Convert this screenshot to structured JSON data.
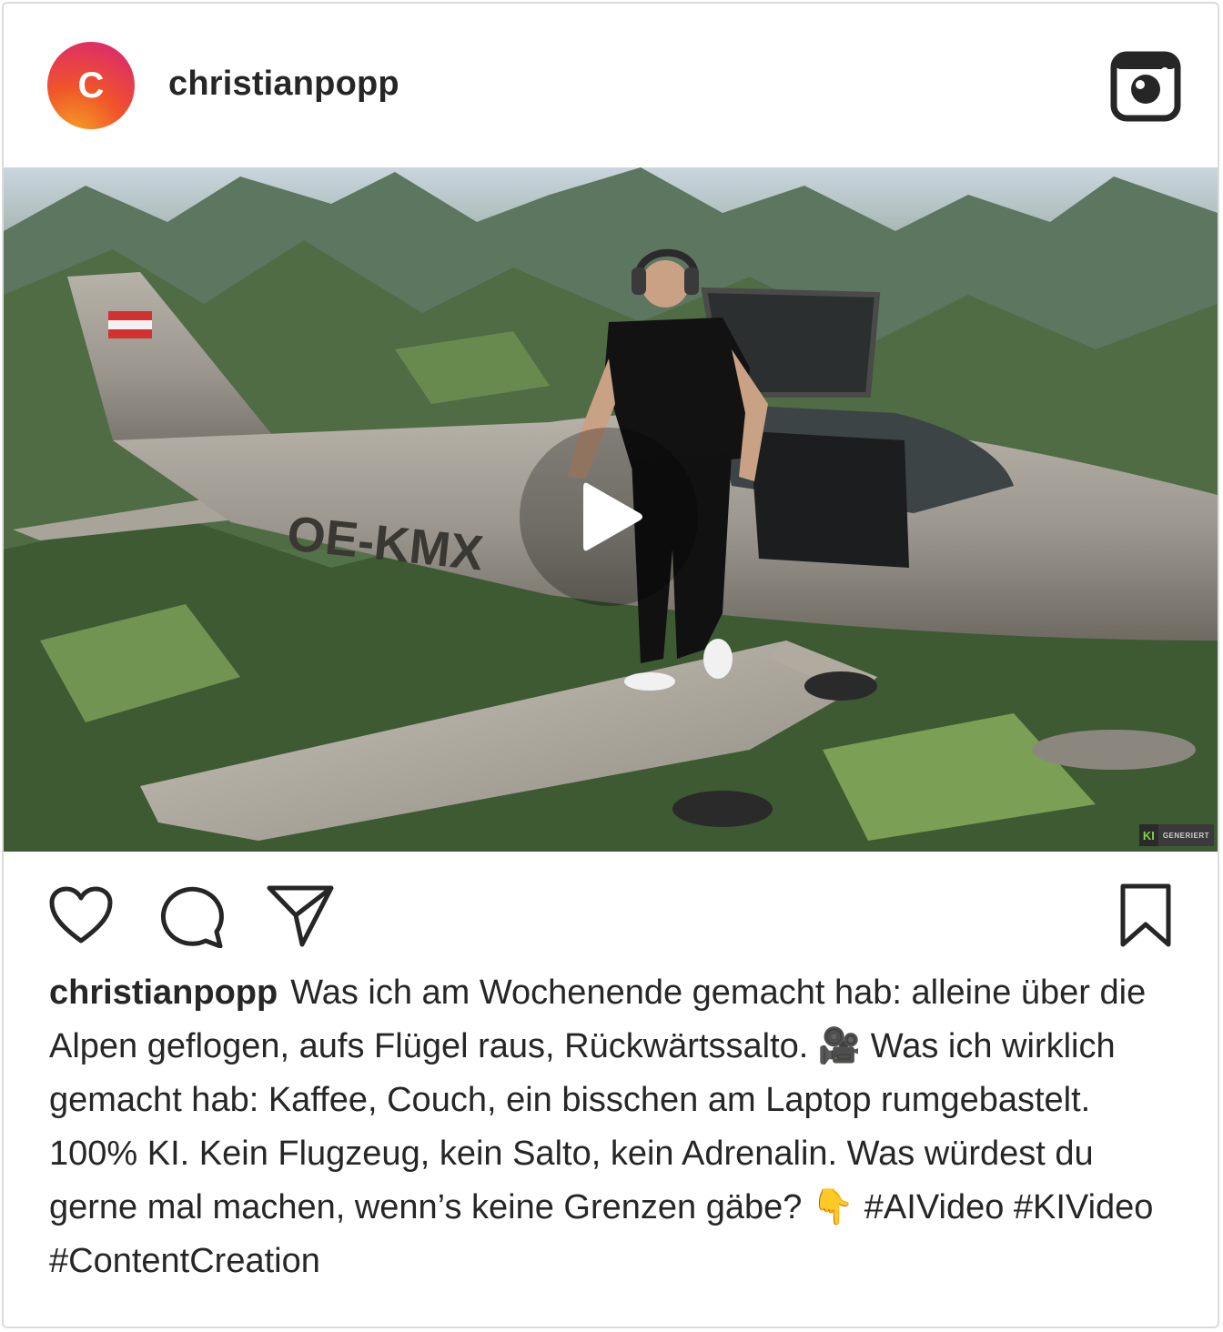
{
  "post": {
    "avatar_initial": "C",
    "username": "christianpopp",
    "platform_icon": "instagram-icon",
    "media": {
      "type": "video",
      "aircraft_registration": "OE-KMX",
      "ai_badge": {
        "ki": "KI",
        "label": "GENERIERT"
      },
      "play_icon": "play-icon"
    },
    "actions": {
      "like_icon": "heart-icon",
      "comment_icon": "comment-icon",
      "share_icon": "share-icon",
      "save_icon": "bookmark-icon"
    },
    "caption": {
      "author": "christianpopp",
      "text": "Was ich am Wochenende gemacht hab: alleine über die Alpen geflogen, aufs Flügel raus, Rückwärtssalto. 🎥 Was ich wirklich gemacht hab: Kaffee, Couch, ein bisschen am Laptop rumgebastelt. 100% KI. Kein Flugzeug, kein Salto, kein Adrenalin. Was würdest du gerne mal machen, wenn’s keine Grenzen gäbe? 👇 #AIVideo #KIVideo #ContentCreation"
    }
  },
  "colors": {
    "text": "#262626",
    "border": "#dbdbdb",
    "avatar_gradient": [
      "#f6a623",
      "#f0542a",
      "#d8217a"
    ]
  }
}
